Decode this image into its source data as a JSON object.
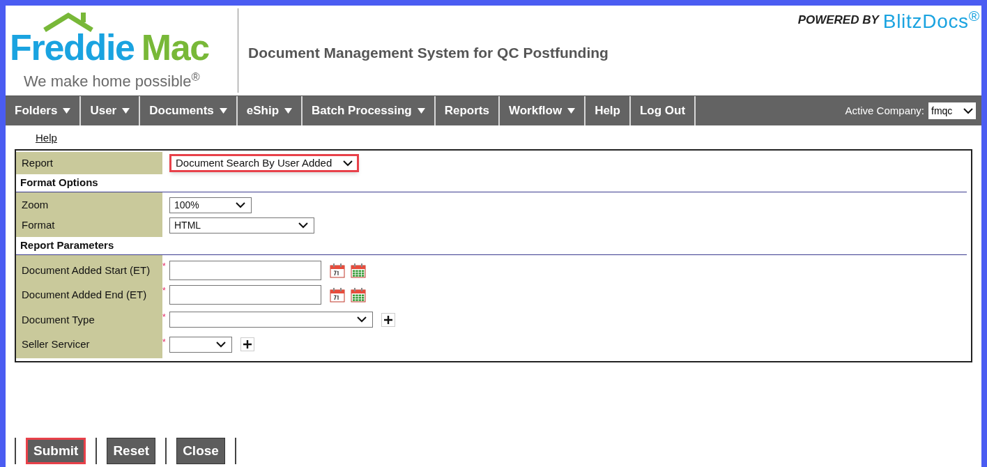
{
  "header": {
    "logo_name_part1": "Freddie",
    "logo_name_part2": "Mac",
    "tagline": "We make home possible$^{®}$",
    "title": "Document Management System for QC Postfunding",
    "powered_by": "POWERED BY",
    "powered_brand": "BlitzDocs$^{®}$"
  },
  "menu": [
    {
      "label": "Folders",
      "has_dropdown": true
    },
    {
      "label": "User",
      "has_dropdown": true
    },
    {
      "label": "Documents",
      "has_dropdown": true
    },
    {
      "label": "eShip",
      "has_dropdown": true
    },
    {
      "label": "Batch Processing",
      "has_dropdown": true
    },
    {
      "label": "Reports",
      "has_dropdown": false
    },
    {
      "label": "Workflow",
      "has_dropdown": true
    },
    {
      "label": "Help",
      "has_dropdown": false
    },
    {
      "label": "Log Out",
      "has_dropdown": false
    }
  ],
  "active_company": {
    "label": "Active Company:",
    "value": "fmqc"
  },
  "help_link": "Help",
  "report": {
    "label": "Report",
    "value": "Document Search By User Added",
    "highlighted": true
  },
  "sections": [
    {
      "heading": "Format Options",
      "rows": [
        {
          "kind": "select",
          "label": "Zoom",
          "value": "100%"
        },
        {
          "kind": "select",
          "label": "Format",
          "value": "HTML"
        }
      ]
    },
    {
      "heading": "Report Parameters",
      "rows": [
        {
          "kind": "date",
          "label": "Document Added Start (ET)",
          "required_mark": "*"
        },
        {
          "kind": "date",
          "label": "Document Added End (ET)",
          "required_mark": "*"
        },
        {
          "kind": "select_add",
          "label": "Document Type",
          "required_mark": "*"
        },
        {
          "kind": "select_add",
          "label": "Seller Servicer",
          "required_mark": "*"
        }
      ]
    }
  ],
  "buttons": [
    {
      "label": "Submit",
      "highlighted": true
    },
    {
      "label": "Reset",
      "highlighted": false
    },
    {
      "label": "Close",
      "highlighted": false
    }
  ]
}
